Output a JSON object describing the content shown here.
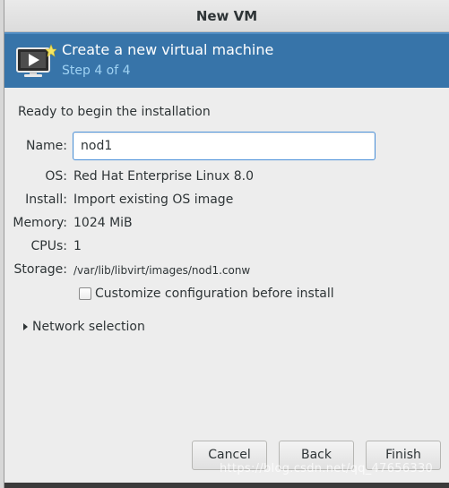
{
  "window": {
    "title": "New VM"
  },
  "banner": {
    "icon": "monitor-new-icon",
    "title": "Create a new virtual machine",
    "step": "Step 4 of 4"
  },
  "main": {
    "ready_text": "Ready to begin the installation",
    "name_label": "Name:",
    "name_value": "nod1",
    "os_label": "OS:",
    "os_value": "Red Hat Enterprise Linux 8.0",
    "install_label": "Install:",
    "install_value": "Import existing OS image",
    "memory_label": "Memory:",
    "memory_value": "1024 MiB",
    "cpus_label": "CPUs:",
    "cpus_value": "1",
    "storage_label": "Storage:",
    "storage_value": "/var/lib/libvirt/images/nod1.conw",
    "customize_label": "Customize configuration before install",
    "customize_checked": false,
    "network_label": "Network selection"
  },
  "buttons": {
    "cancel": "Cancel",
    "back": "Back",
    "finish": "Finish"
  },
  "watermark": "https://blog.csdn.net/qq_47656330",
  "colors": {
    "banner": "#3774a9",
    "banner_subtitle": "#9fd2f3",
    "focus_border": "#4a90d9"
  }
}
